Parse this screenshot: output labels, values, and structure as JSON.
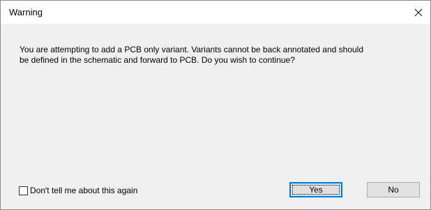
{
  "dialog": {
    "title": "Warning",
    "close_icon": "close-icon",
    "message_line1": "You are attempting to add a PCB only variant. Variants cannot be back annotated and should",
    "message_line2": "be defined in the schematic and forward to PCB. Do you wish to continue?",
    "checkbox": {
      "label": "Don't tell me about this again",
      "checked": false
    },
    "buttons": {
      "yes_label": "Yes",
      "no_label": "No"
    }
  },
  "colors": {
    "titlebar_bg": "#ffffff",
    "body_bg": "#f0f0f0",
    "button_bg": "#e1e1e1",
    "focus_border": "#0078d7"
  }
}
